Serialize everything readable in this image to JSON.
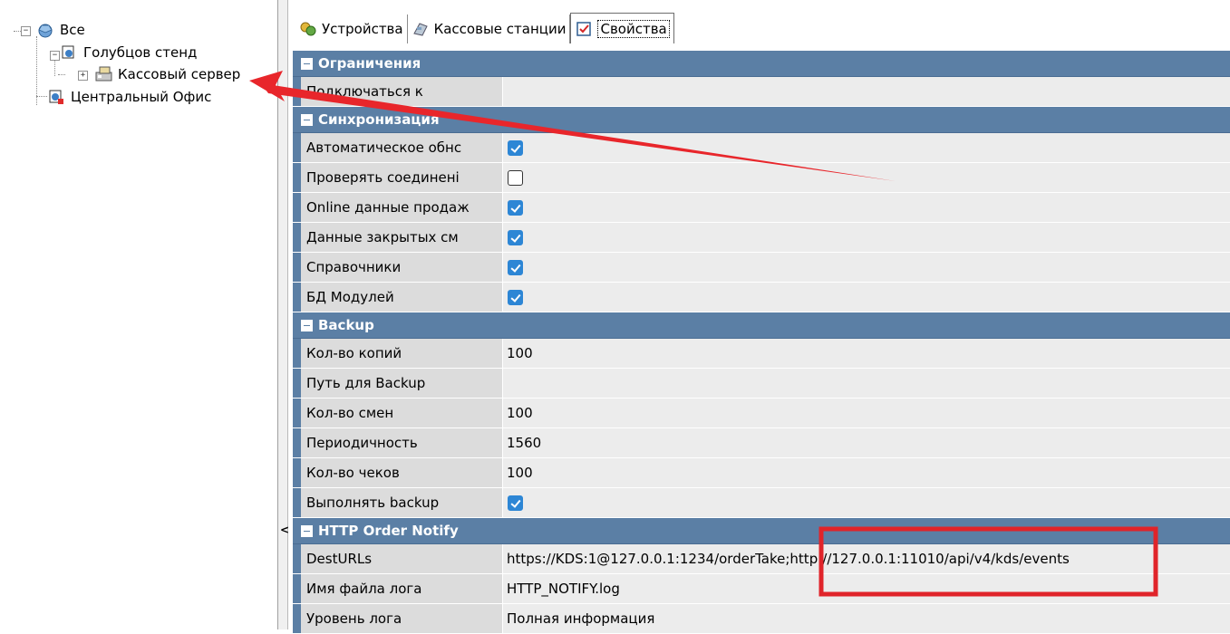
{
  "tree": {
    "items": [
      {
        "label": "Все",
        "icon": "network-root-icon"
      },
      {
        "label": "Голубцов стенд",
        "icon": "node-server-icon"
      },
      {
        "label": "Кассовый сервер",
        "icon": "cash-server-icon"
      },
      {
        "label": "Центральный Офис",
        "icon": "office-node-icon"
      }
    ]
  },
  "splitter": {
    "collapse_glyph": "<"
  },
  "tabs": [
    {
      "label": "Устройства",
      "icon": "devices-icon"
    },
    {
      "label": "Кассовые станции",
      "icon": "cash-stations-icon"
    },
    {
      "label": "Свойства",
      "icon": "properties-icon"
    }
  ],
  "properties": {
    "categories": [
      {
        "title": "Ограничения",
        "rows": [
          {
            "name": "Подключаться к",
            "value": ""
          }
        ]
      },
      {
        "title": "Синхронизация",
        "rows": [
          {
            "name": "Автоматическое обнс",
            "checked": true
          },
          {
            "name": "Проверять соединені",
            "checked": false
          },
          {
            "name": "Online данные продаж",
            "checked": true
          },
          {
            "name": "Данные закрытых см",
            "checked": true
          },
          {
            "name": "Справочники",
            "checked": true
          },
          {
            "name": "БД Модулей",
            "checked": true
          }
        ]
      },
      {
        "title": "Backup",
        "rows": [
          {
            "name": "Кол-во копий",
            "value": "100"
          },
          {
            "name": "Путь для Backup",
            "value": ""
          },
          {
            "name": "Кол-во смен",
            "value": "100"
          },
          {
            "name": "Периодичность",
            "value": "1560"
          },
          {
            "name": "Кол-во чеков",
            "value": "100"
          },
          {
            "name": "Выполнять backup",
            "checked": true
          }
        ]
      },
      {
        "title": "HTTP Order Notify",
        "rows": [
          {
            "name": "DestURLs",
            "value": "https://KDS:1@127.0.0.1:1234/orderTake;http://127.0.0.1:11010/api/v4/kds/events"
          },
          {
            "name": "Имя файла лога",
            "value": "HTTP_NOTIFY.log"
          },
          {
            "name": "Уровень лога",
            "value": "Полная информация"
          }
        ]
      }
    ]
  },
  "annotations": {
    "arrow_color": "#e8262b",
    "box_color": "#e0242a"
  },
  "colors": {
    "category_bg": "#5b7fa5",
    "name_bg": "#dcdcdc",
    "value_bg": "#ececec",
    "check_on": "#2d86d5"
  }
}
